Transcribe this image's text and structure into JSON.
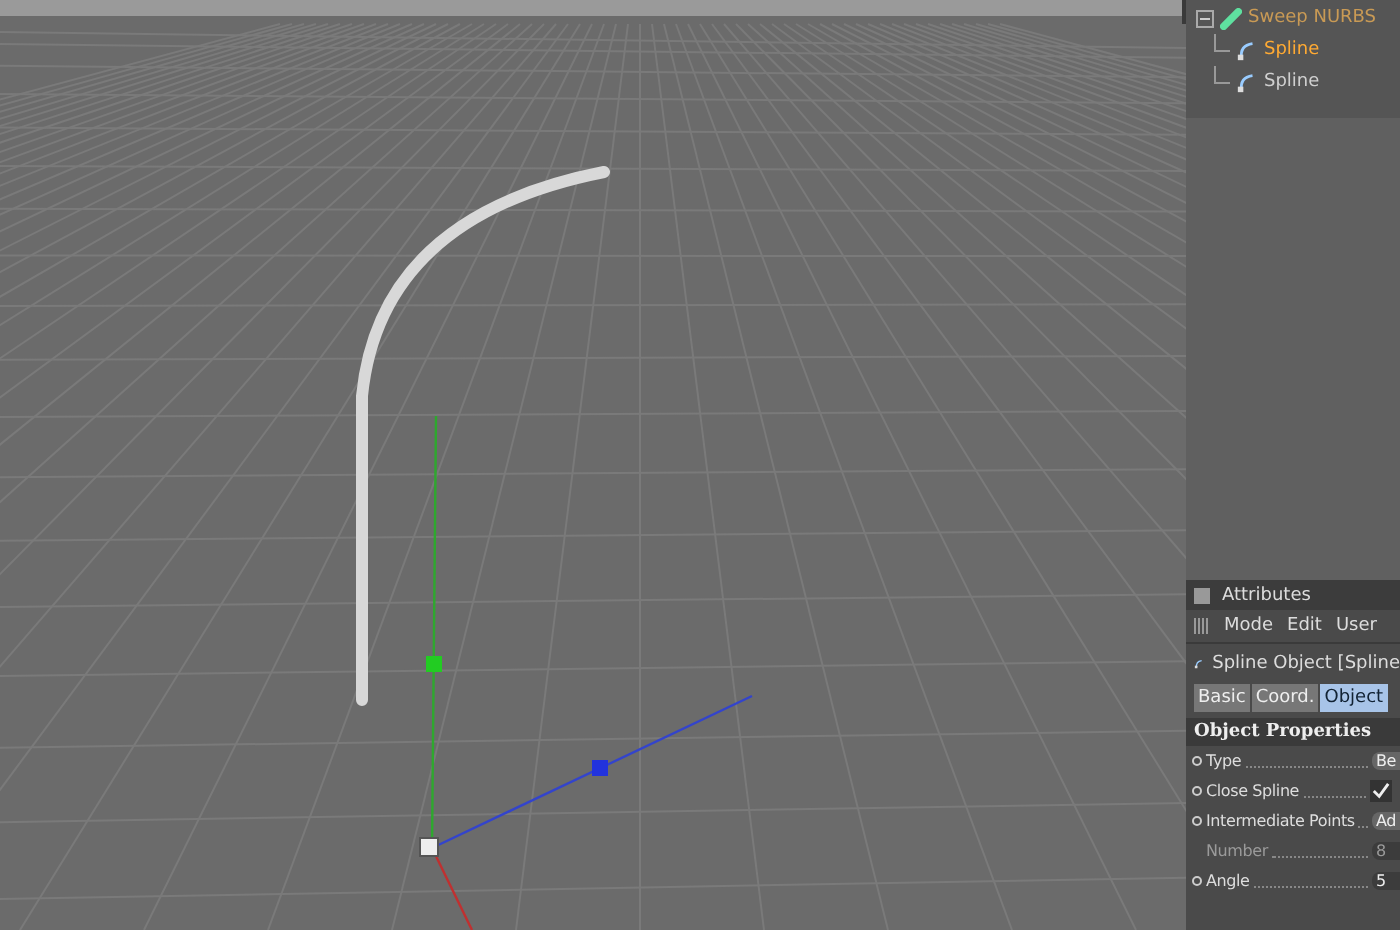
{
  "object_manager": {
    "tree": [
      {
        "label": "Sweep NURBS",
        "expanded": true,
        "selected": false,
        "children": [
          {
            "label": "Spline",
            "selected": true
          },
          {
            "label": "Spline",
            "selected": false
          }
        ]
      }
    ]
  },
  "attributes": {
    "title": "Attributes",
    "menu": [
      "Mode",
      "Edit",
      "User"
    ],
    "object_title": "Spline Object [Spline",
    "tabs": [
      {
        "label": "Basic",
        "selected": false
      },
      {
        "label": "Coord.",
        "selected": false
      },
      {
        "label": "Object",
        "selected": true
      }
    ],
    "section": "Object Properties",
    "properties": [
      {
        "kind": "dropdown",
        "label": "Type",
        "value": "Be",
        "disabled": false
      },
      {
        "kind": "checkbox",
        "label": "Close Spline",
        "checked": true,
        "disabled": false
      },
      {
        "kind": "dropdown",
        "label": "Intermediate Points",
        "value": "Ad",
        "disabled": false
      },
      {
        "kind": "number",
        "label": "Number",
        "value": "8",
        "disabled": true
      },
      {
        "kind": "number",
        "label": "Angle",
        "value": "5",
        "disabled": false
      }
    ]
  }
}
